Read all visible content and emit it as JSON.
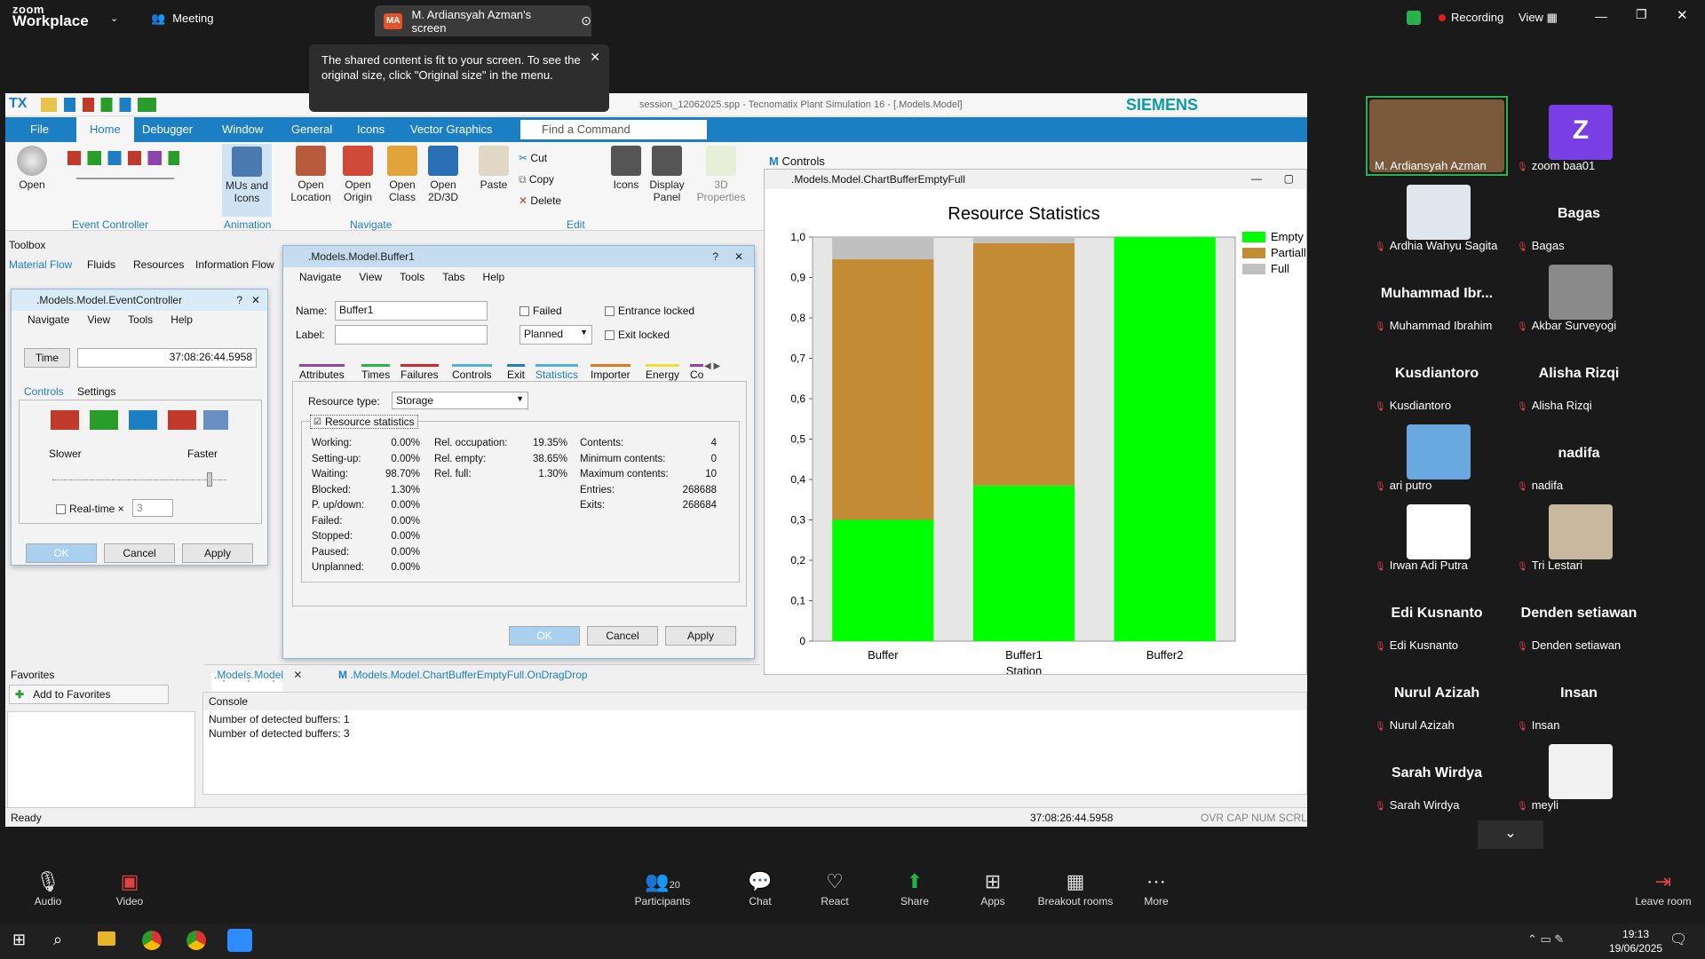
{
  "zoom": {
    "brand_top": "zoom",
    "brand_bottom": "Workplace",
    "meeting_label": "Meeting",
    "share_initials": "MA",
    "share_title": "M. Ardiansyah Azman's screen",
    "tooltip": "The shared content is fit to your screen. To see the original size, click \"Original size\" in the menu.",
    "recording": "Recording",
    "view": "View"
  },
  "app": {
    "title": "session_12062025.spp - Tecnomatix Plant Simulation 16 - [.Models.Model]",
    "brand": "SIEMENS",
    "menu": [
      "File",
      "Home",
      "Debugger",
      "Window",
      "General",
      "Icons",
      "Vector Graphics"
    ],
    "find_placeholder": "Find a Command",
    "ribbon": {
      "open": "Open",
      "mus_icons": "MUs and Icons",
      "open_location": "Open Location",
      "open_origin": "Open Origin",
      "open_class": "Open Class",
      "open_2d3d": "Open 2D/3D",
      "paste": "Paste",
      "cut": "Cut",
      "copy": "Copy",
      "delete": "Delete",
      "icons": "Icons",
      "display_panel": "Display Panel",
      "properties_3d": "3D Properties",
      "controls": "Controls"
    },
    "groups": {
      "event_controller": "Event Controller",
      "animation": "Animation",
      "navigate": "Navigate",
      "edit": "Edit"
    },
    "toolbox": "Toolbox",
    "toolbox_tabs": [
      "Material Flow",
      "Fluids",
      "Resources",
      "Information Flow"
    ],
    "favorites": "Favorites",
    "add_favorites": "Add to Favorites",
    "doc_tabs": [
      ".Models.Model",
      ".Models.Model.ChartBufferEmptyFull.OnDragDrop"
    ],
    "console_title": "Console",
    "console_lines": [
      "Number of detected buffers: 1",
      "Number of detected buffers: 3"
    ],
    "status": "Ready",
    "status_time": "37:08:26:44.5958",
    "status_flags": "OVR CAP NUM SCRL"
  },
  "event_controller": {
    "title": ".Models.Model.EventController",
    "menu": [
      "Navigate",
      "View",
      "Tools",
      "Help"
    ],
    "time_label": "Time",
    "time_value": "37:08:26:44.5958",
    "tabs": [
      "Controls",
      "Settings"
    ],
    "slower": "Slower",
    "faster": "Faster",
    "realtime": "Real-time ×",
    "realtime_value": "3",
    "ok": "OK",
    "cancel": "Cancel",
    "apply": "Apply"
  },
  "buffer_dialog": {
    "title": ".Models.Model.Buffer1",
    "menu": [
      "Navigate",
      "View",
      "Tools",
      "Tabs",
      "Help"
    ],
    "name_label": "Name:",
    "name_value": "Buffer1",
    "label_label": "Label:",
    "failed": "Failed",
    "planned": "Planned",
    "entrance_locked": "Entrance locked",
    "exit_locked": "Exit locked",
    "tabs": [
      "Attributes",
      "Times",
      "Failures",
      "Controls",
      "Exit",
      "Statistics",
      "Importer",
      "Energy",
      "Co"
    ],
    "resource_type_label": "Resource type:",
    "resource_type_value": "Storage",
    "resource_statistics": "Resource statistics",
    "stats_col1": [
      [
        "Working:",
        "0.00%"
      ],
      [
        "Setting-up:",
        "0.00%"
      ],
      [
        "Waiting:",
        "98.70%"
      ],
      [
        "Blocked:",
        "1.30%"
      ],
      [
        "P. up/down:",
        "0.00%"
      ],
      [
        "Failed:",
        "0.00%"
      ],
      [
        "Stopped:",
        "0.00%"
      ],
      [
        "Paused:",
        "0.00%"
      ],
      [
        "Unplanned:",
        "0.00%"
      ]
    ],
    "stats_col2": [
      [
        "Rel. occupation:",
        "19.35%"
      ],
      [
        "Rel. empty:",
        "38.65%"
      ],
      [
        "Rel. full:",
        "1.30%"
      ]
    ],
    "stats_col3": [
      [
        "Contents:",
        "4"
      ],
      [
        "Minimum contents:",
        "0"
      ],
      [
        "Maximum contents:",
        "10"
      ],
      [
        "Entries:",
        "268688"
      ],
      [
        "Exits:",
        "268684"
      ]
    ],
    "ok": "OK",
    "cancel": "Cancel",
    "apply": "Apply"
  },
  "chart_window": {
    "title": ".Models.Model.ChartBufferEmptyFull"
  },
  "chart_data": {
    "type": "bar",
    "title": "Resource Statistics",
    "categories": [
      "Buffer",
      "Buffer1",
      "Buffer2"
    ],
    "xlabel": "Station",
    "ylim": [
      0,
      1
    ],
    "yticks": [
      "0",
      "0,1",
      "0,2",
      "0,3",
      "0,4",
      "0,5",
      "0,6",
      "0,7",
      "0,8",
      "0,9",
      "1,0"
    ],
    "stacked": true,
    "series": [
      {
        "name": "Empty",
        "color": "#00ff00",
        "values": [
          0.3,
          0.385,
          1.0
        ]
      },
      {
        "name": "Partially",
        "color": "#c48b35",
        "values": [
          0.645,
          0.6,
          0.0
        ]
      },
      {
        "name": "Full",
        "color": "#c0c0c0",
        "values": [
          0.055,
          0.015,
          0.0
        ]
      }
    ],
    "legend": "top-right"
  },
  "participants": [
    {
      "name": "M. Ardiansyah Azman",
      "video": true,
      "color": "#7b5a3c"
    },
    {
      "name": "zoom baa01",
      "initial": "Z",
      "color": "#7a3fe4"
    },
    {
      "name": "Ardhia Wahyu Sagita",
      "video": true,
      "color": "#dfe6ee"
    },
    {
      "name": "Bagas",
      "display": "Bagas"
    },
    {
      "name": "Muhammad Ibrahim",
      "display": "Muhammad Ibr..."
    },
    {
      "name": "Akbar Surveyogi",
      "video": true,
      "color": "#8a8a8a"
    },
    {
      "name": "Kusdiantoro",
      "display": "Kusdiantoro"
    },
    {
      "name": "Alisha Rizqi",
      "display": "Alisha Rizqi"
    },
    {
      "name": "ari putro",
      "video": true,
      "color": "#6aa8e0"
    },
    {
      "name": "nadifa",
      "display": "nadifa"
    },
    {
      "name": "Irwan Adi Putra",
      "video": true,
      "color": "#ffffff"
    },
    {
      "name": "Tri Lestari",
      "video": true,
      "color": "#c9b8a0"
    },
    {
      "name": "Edi Kusnanto",
      "display": "Edi Kusnanto"
    },
    {
      "name": "Denden setiawan",
      "display": "Denden setiawan"
    },
    {
      "name": "Nurul Azizah",
      "display": "Nurul Azizah"
    },
    {
      "name": "Insan",
      "display": "Insan"
    },
    {
      "name": "Sarah Wirdya",
      "display": "Sarah Wirdya"
    },
    {
      "name": "meyli",
      "video": true,
      "color": "#f2f2f2"
    }
  ],
  "controls": {
    "audio": "Audio",
    "video": "Video",
    "participants": "Participants",
    "participants_count": "20",
    "chat": "Chat",
    "react": "React",
    "share": "Share",
    "apps": "Apps",
    "breakout": "Breakout rooms",
    "more": "More",
    "leave": "Leave room"
  },
  "taskbar": {
    "time": "19:13",
    "date": "19/06/2025"
  }
}
